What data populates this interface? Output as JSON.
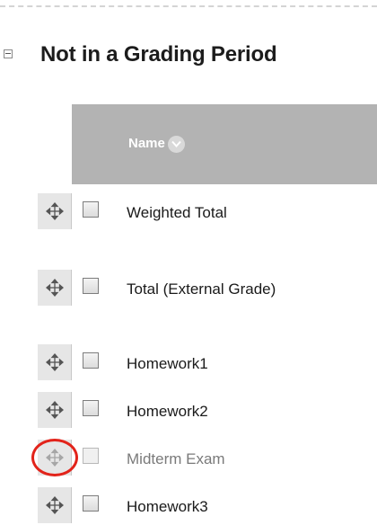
{
  "section": {
    "title": "Not in a Grading Period"
  },
  "table": {
    "columns": {
      "name": "Name"
    },
    "rows": [
      {
        "label": "Weighted Total",
        "disabled": false
      },
      {
        "label": "Total (External Grade)",
        "disabled": false
      },
      {
        "label": "Homework1",
        "disabled": false
      },
      {
        "label": "Homework2",
        "disabled": false
      },
      {
        "label": "Midterm Exam",
        "disabled": true
      },
      {
        "label": "Homework3",
        "disabled": false
      }
    ]
  },
  "icons": {
    "collapse": "minus-square-icon",
    "sort": "chevron-down-icon",
    "drag": "move-arrows-icon"
  },
  "colors": {
    "header_bg": "#b3b3b3",
    "highlight": "#e2231a"
  }
}
